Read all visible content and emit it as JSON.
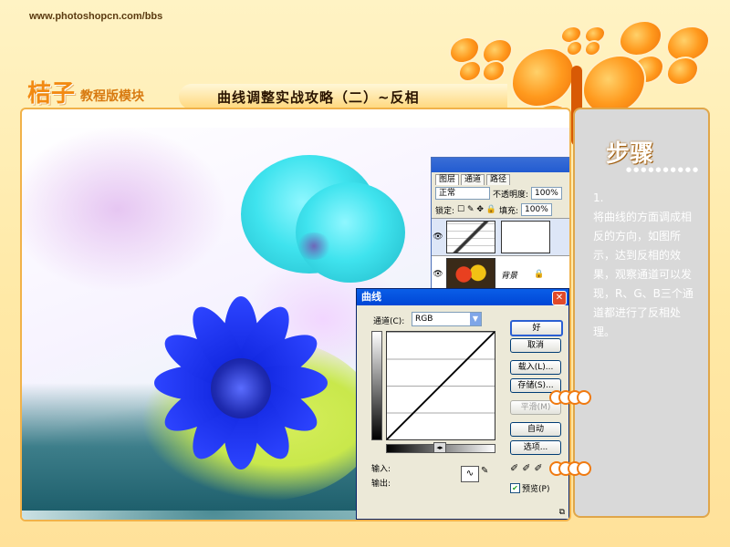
{
  "site": {
    "url": "www.photoshopcn.com/bbs",
    "brand_big": "桔子",
    "brand_small": "教程版模块",
    "title": "曲线调整实战攻略（二）~反相"
  },
  "layers_panel": {
    "tabs": [
      "图层",
      "通道",
      "路径"
    ],
    "blend_mode": "正常",
    "opacity_label": "不透明度:",
    "opacity_value": "100%",
    "lock_label": "锁定:",
    "fill_label": "填充:",
    "fill_value": "100%",
    "background_layer_name": "背景"
  },
  "curves_dialog": {
    "title": "曲线",
    "channel_label": "通道(C):",
    "channel_value": "RGB",
    "buttons": {
      "ok": "好",
      "cancel": "取消",
      "load": "载入(L)...",
      "save": "存储(S)...",
      "smooth": "平滑(M)",
      "auto": "自动",
      "options": "选项..."
    },
    "input_label": "输入:",
    "output_label": "输出:",
    "preview_label": "预览(P)"
  },
  "steps": {
    "heading": "步骤",
    "number": "1.",
    "text": "将曲线的方面调成相反的方向，如图所示，达到反相的效果，观察通道可以发现，R、G、B三个通道都进行了反相处理。"
  },
  "colors": {
    "accent_orange": "#f28a12",
    "dialog_title_blue": "#0a5ee8",
    "panel_gray": "#d9d9d9"
  }
}
